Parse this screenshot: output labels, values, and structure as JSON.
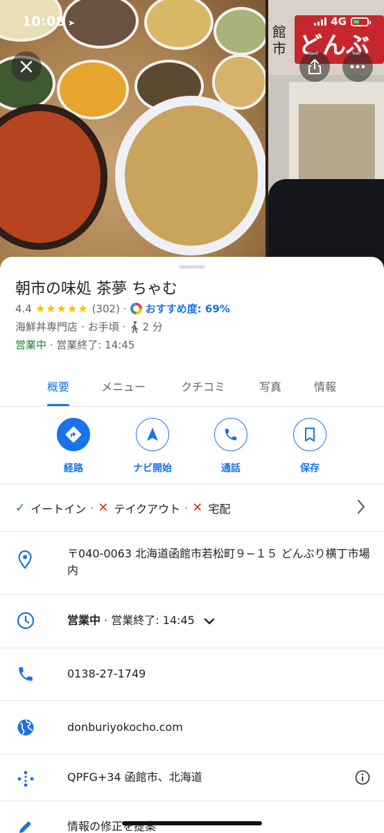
{
  "status_bar": {
    "time": "10:08",
    "network": "4G",
    "battery_color": "#4cd964"
  },
  "hero": {
    "close_icon": "close-icon",
    "share_icon": "share-icon",
    "more_icon": "more-horiz-icon",
    "shop_sign_text": "どんぶ",
    "shop_sign_side_text": "館市"
  },
  "place": {
    "name": "朝市の味処 茶夢 ちゃむ",
    "rating": "4.4",
    "stars": "★★★★★",
    "review_count": "(302)",
    "recommend_label": "おすすめ度: 69%",
    "category": "海鮮丼専門店",
    "price": "お手頃",
    "walk_time": "2 分",
    "open_status": "営業中",
    "closing_time": "営業終了: 14:45"
  },
  "tabs": [
    {
      "label": "概要",
      "active": true
    },
    {
      "label": "メニュー",
      "active": false
    },
    {
      "label": "クチコミ",
      "active": false
    },
    {
      "label": "写真",
      "active": false
    },
    {
      "label": "情報",
      "active": false
    }
  ],
  "actions": [
    {
      "label": "経路",
      "icon": "directions-icon"
    },
    {
      "label": "ナビ開始",
      "icon": "navigation-arrow-icon"
    },
    {
      "label": "通話",
      "icon": "phone-icon"
    },
    {
      "label": "保存",
      "icon": "bookmark-icon"
    }
  ],
  "services": {
    "dine_in": "イートイン",
    "takeout": "テイクアウト",
    "delivery": "宅配"
  },
  "info": {
    "address": "〒040-0063 北海道函館市若松町９−１５ どんぶり横丁市場内",
    "hours_status": "営業中",
    "hours_closing": "営業終了: 14:45",
    "phone": "0138-27-1749",
    "website": "donburiyokocho.com",
    "plus_code": "QPFG+34 函館市、北海道",
    "suggest_edit": "情報の修正を提案"
  },
  "colors": {
    "accent": "#1a73e8",
    "open_green": "#188038",
    "cross_red": "#d93025",
    "star_yellow": "#fbbc04"
  }
}
